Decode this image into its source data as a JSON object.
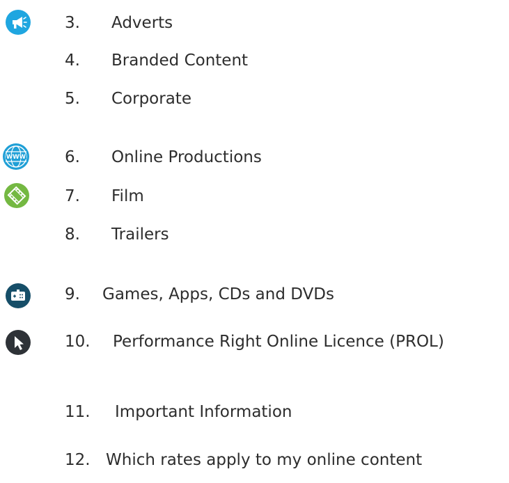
{
  "items": [
    {
      "number": "3.",
      "label": "Adverts",
      "icon": "megaphone-icon"
    },
    {
      "number": "4.",
      "label": "Branded Content"
    },
    {
      "number": "5.",
      "label": "Corporate"
    },
    {
      "number": "6.",
      "label": "Online Productions",
      "icon": "www-globe-icon"
    },
    {
      "number": "7.",
      "label": "Film",
      "icon": "film-strip-icon"
    },
    {
      "number": "8.",
      "label": "Trailers"
    },
    {
      "number": "9.",
      "label": "Games, Apps, CDs and DVDs",
      "icon": "gamepad-icon"
    },
    {
      "number": "10.",
      "label": "Performance Right Online Licence (PROL)",
      "icon": "cursor-arrow-icon"
    },
    {
      "number": "11.",
      "label": "Important Information"
    },
    {
      "number": "12.",
      "label": "Which rates apply to my online content"
    }
  ],
  "colors": {
    "text": "#2d2d2d",
    "adverts_icon": "#1fa6e0",
    "online_icon": "#1f9fd6",
    "film_icon": "#74b842",
    "games_icon": "#164e68",
    "cursor_icon": "#2e3237"
  }
}
